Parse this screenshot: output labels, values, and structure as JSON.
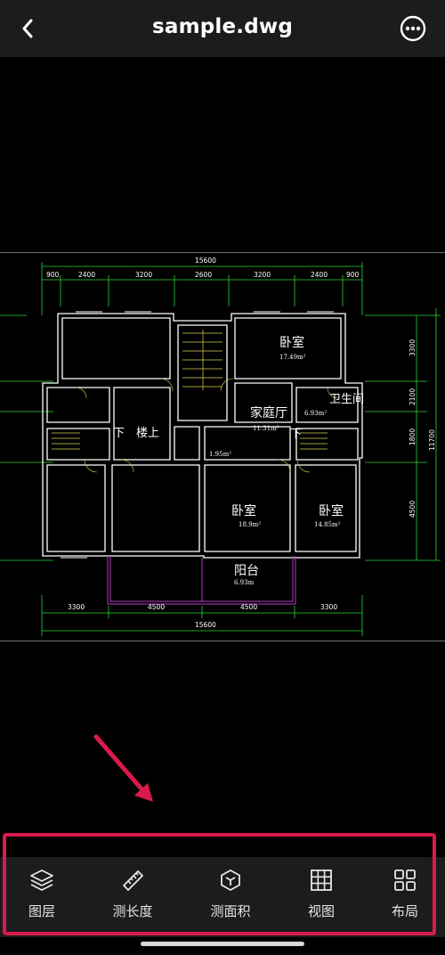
{
  "header": {
    "title": "sample.dwg"
  },
  "drawing": {
    "overall_width_top": "15600",
    "overall_width_bottom": "15600",
    "top_dims": [
      "900",
      "2400",
      "3200",
      "2600",
      "3200",
      "2400",
      "900"
    ],
    "bottom_dims": [
      "3300",
      "4500",
      "4500",
      "3300"
    ],
    "right_dims": [
      "3300",
      "2100",
      "1800",
      "4500"
    ],
    "right_total": "11700",
    "rooms": {
      "bedroom_ne_name": "卧室",
      "bedroom_ne_area": "17.49m²",
      "bathroom_name": "卫生间",
      "bathroom_area": "6.93m²",
      "family_hall_name": "家庭厅",
      "family_hall_area": "11.31m²",
      "down_left": "下",
      "upstairs": "楼上",
      "down_right": "下",
      "closet_area": "1.95m²",
      "bedroom_s_name": "卧室",
      "bedroom_s_area": "18.9m²",
      "bedroom_se_name": "卧室",
      "bedroom_se_area": "14.85m²",
      "balcony_name": "阳台",
      "balcony_area": "6.93m"
    }
  },
  "toolbar": {
    "items": [
      {
        "label": "图层",
        "icon": "layers-icon"
      },
      {
        "label": "测长度",
        "icon": "ruler-icon"
      },
      {
        "label": "测面积",
        "icon": "cube-icon"
      },
      {
        "label": "视图",
        "icon": "grid-icon"
      },
      {
        "label": "布局",
        "icon": "layout-icon"
      }
    ]
  },
  "colors": {
    "accent_highlight": "#d81b4a",
    "header_bg": "#1c1c1e",
    "cad_dim_green": "#2bd63a",
    "cad_wall_white": "#ffffff",
    "cad_balcony_magenta": "#b93cc8",
    "cad_stair_yellow": "#d8d24a"
  }
}
